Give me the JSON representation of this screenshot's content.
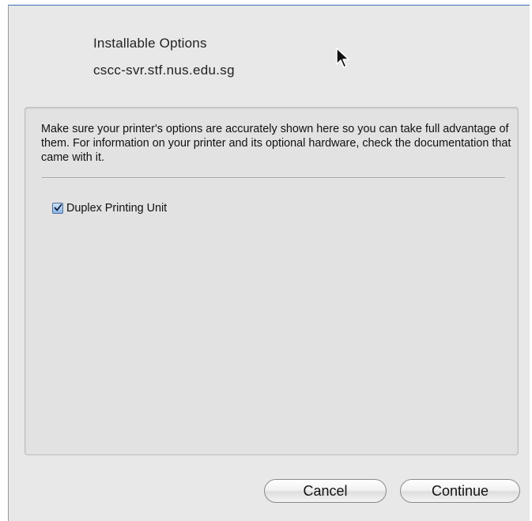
{
  "header": {
    "title": "Installable Options",
    "host": "cscc-svr.stf.nus.edu.sg"
  },
  "panel": {
    "description": "Make sure your printer's options are accurately shown here so you can take full advantage of them.  For information on your printer and its optional hardware, check the documentation that came with it.",
    "options": [
      {
        "label": "Duplex Printing Unit",
        "checked": true
      }
    ]
  },
  "buttons": {
    "cancel": "Cancel",
    "continue": "Continue"
  },
  "icons": {
    "cursor": "arrow-cursor-icon",
    "checkbox": "checkmark-icon"
  },
  "colors": {
    "checkbox_fill": "#8db4e6",
    "window_background": "#e8e8e8"
  }
}
